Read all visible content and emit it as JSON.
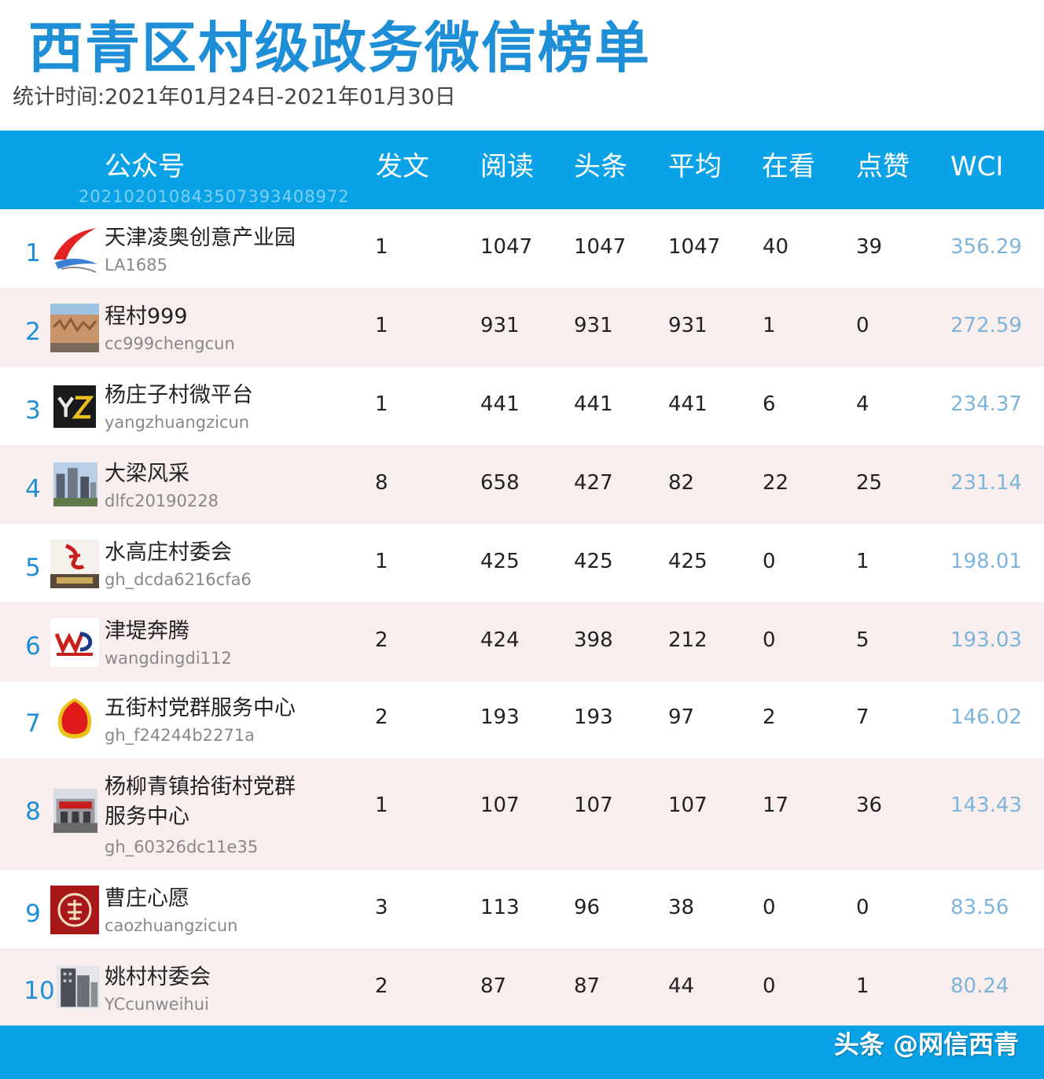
{
  "title": "西青区村级政务微信榜单",
  "period": "统计时间:2021年01月24日-2021年01月30日",
  "header": {
    "account": "公众号",
    "account_id": "20210201084350739340897​2",
    "posts": "发文",
    "reads": "阅读",
    "headline": "头条",
    "average": "平均",
    "watching": "在看",
    "likes": "点赞",
    "wci": "WCI"
  },
  "rows": [
    {
      "rank": "1",
      "name": "天津凌奥创意产业园",
      "account": "LA1685",
      "posts": "1",
      "reads": "1047",
      "headline": "1047",
      "average": "1047",
      "watching": "40",
      "likes": "39",
      "wci": "356.29",
      "avatar": "swoosh-logo-icon"
    },
    {
      "rank": "2",
      "name": "程村999",
      "account": "cc999chengcun",
      "posts": "1",
      "reads": "931",
      "headline": "931",
      "average": "931",
      "watching": "1",
      "likes": "0",
      "wci": "272.59",
      "avatar": "mural-photo-icon"
    },
    {
      "rank": "3",
      "name": "杨庄子村微平台",
      "account": "yangzhuangzicun",
      "posts": "1",
      "reads": "441",
      "headline": "441",
      "average": "441",
      "watching": "6",
      "likes": "4",
      "wci": "234.37",
      "avatar": "yz-logo-icon"
    },
    {
      "rank": "4",
      "name": "大梁风采",
      "account": "dlfc20190228",
      "posts": "8",
      "reads": "658",
      "headline": "427",
      "average": "82",
      "watching": "22",
      "likes": "25",
      "wci": "231.14",
      "avatar": "buildings-photo-icon"
    },
    {
      "rank": "5",
      "name": "水高庄村委会",
      "account": "gh_dcda6216cfa6",
      "posts": "1",
      "reads": "425",
      "headline": "425",
      "average": "425",
      "watching": "0",
      "likes": "1",
      "wci": "198.01",
      "avatar": "calligraphy-logo-icon"
    },
    {
      "rank": "6",
      "name": "津堤奔腾",
      "account": "wangdingdi112",
      "posts": "2",
      "reads": "424",
      "headline": "398",
      "average": "212",
      "watching": "0",
      "likes": "5",
      "wci": "193.03",
      "avatar": "wdd-logo-icon"
    },
    {
      "rank": "7",
      "name": "五街村党群服务中心",
      "account": "gh_f24244b2271a",
      "posts": "2",
      "reads": "193",
      "headline": "193",
      "average": "97",
      "watching": "2",
      "likes": "7",
      "wci": "146.02",
      "avatar": "red-emblem-icon"
    },
    {
      "rank": "8",
      "name": "杨柳青镇拾街村党群",
      "name2": "服务中心",
      "account": "gh_60326dc11e35",
      "posts": "1",
      "reads": "107",
      "headline": "107",
      "average": "107",
      "watching": "17",
      "likes": "36",
      "wci": "143.43",
      "avatar": "storefront-photo-icon"
    },
    {
      "rank": "9",
      "name": "曹庄心愿",
      "account": "caozhuangzicun",
      "posts": "3",
      "reads": "113",
      "headline": "96",
      "average": "38",
      "watching": "0",
      "likes": "0",
      "wci": "83.56",
      "avatar": "seal-logo-icon"
    },
    {
      "rank": "10",
      "name": "姚村村委会",
      "account": "YCcunweihui",
      "posts": "2",
      "reads": "87",
      "headline": "87",
      "average": "44",
      "watching": "0",
      "likes": "1",
      "wci": "80.24",
      "avatar": "tower-photo-icon"
    }
  ],
  "watermark": "头条 @网信西青",
  "colors": {
    "header_bg": "#0aa2e6",
    "title": "#1e8fd6",
    "wci": "#7fb4da",
    "alt_row": "#f8eeee"
  }
}
